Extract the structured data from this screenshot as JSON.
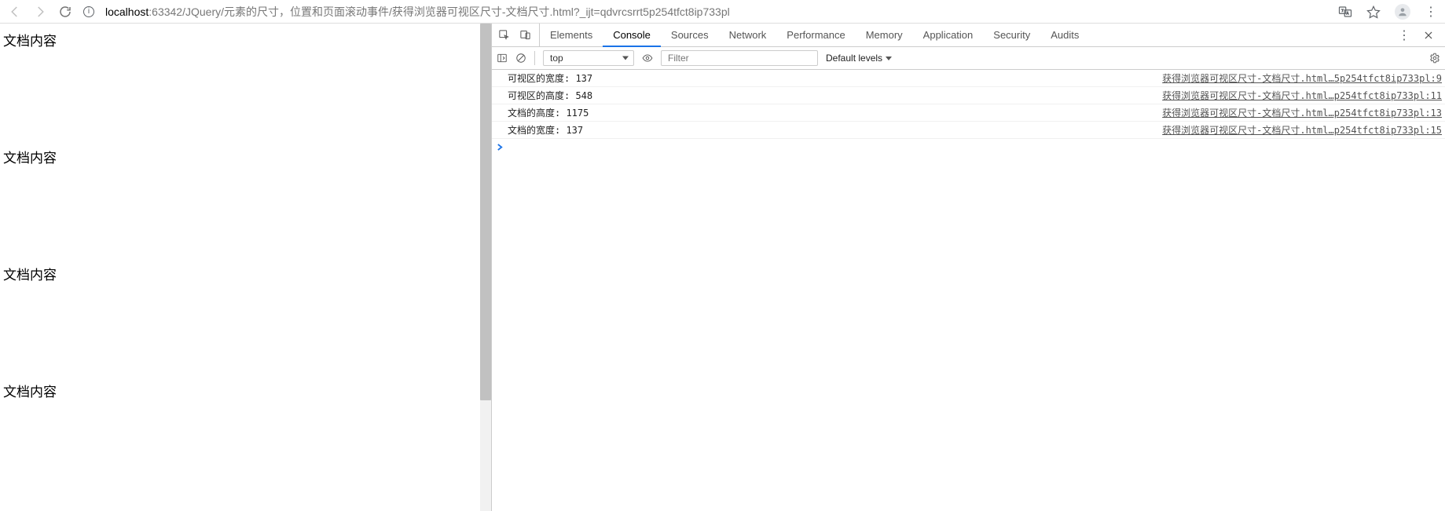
{
  "url": {
    "host_black": "localhost",
    "host_grey": ":63342/JQuery/元素的尺寸，位置和页面滚动事件/获得浏览器可视区尺寸-文档尺寸.html?_ijt=qdvrcsrrt5p254tfct8ip733pl"
  },
  "page": {
    "paragraphs": [
      "文档内容",
      "文档内容",
      "文档内容",
      "文档内容"
    ]
  },
  "devtools": {
    "tabs": [
      "Elements",
      "Console",
      "Sources",
      "Network",
      "Performance",
      "Memory",
      "Application",
      "Security",
      "Audits"
    ],
    "active_tab": "Console",
    "context_selected": "top",
    "filter_placeholder": "Filter",
    "levels_label": "Default levels",
    "console_rows": [
      {
        "msg": "可视区的宽度: 137",
        "src": "获得浏览器可视区尺寸-文档尺寸.html…5p254tfct8ip733pl:9"
      },
      {
        "msg": "可视区的高度: 548",
        "src": "获得浏览器可视区尺寸-文档尺寸.html…p254tfct8ip733pl:11"
      },
      {
        "msg": "文档的高度: 1175",
        "src": "获得浏览器可视区尺寸-文档尺寸.html…p254tfct8ip733pl:13"
      },
      {
        "msg": "文档的宽度: 137",
        "src": "获得浏览器可视区尺寸-文档尺寸.html…p254tfct8ip733pl:15"
      }
    ]
  }
}
